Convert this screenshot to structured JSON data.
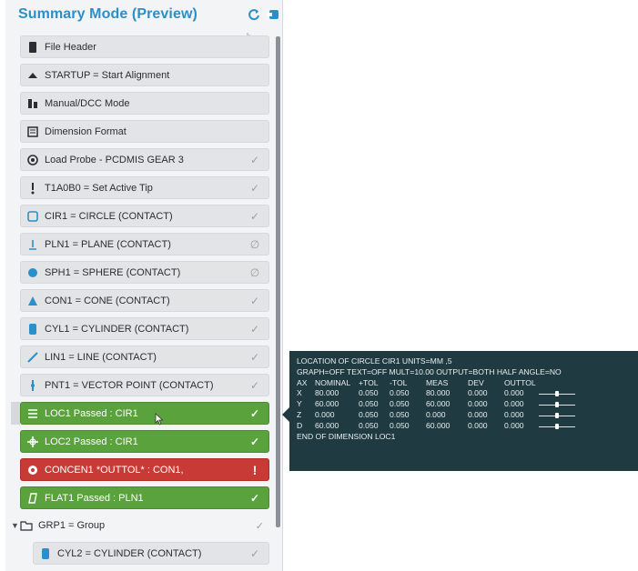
{
  "header": {
    "title": "Summary Mode (Preview)",
    "icons": [
      "refresh-icon",
      "export-icon"
    ]
  },
  "rows": [
    {
      "label": "File Header",
      "icon": "file-icon",
      "status": ""
    },
    {
      "label": "STARTUP = Start Alignment",
      "icon": "alignment-icon",
      "status": ""
    },
    {
      "label": "Manual/DCC Mode",
      "icon": "mode-icon",
      "status": ""
    },
    {
      "label": "Dimension Format",
      "icon": "format-icon",
      "status": ""
    },
    {
      "label": "Load Probe - PCDMIS GEAR 3",
      "icon": "probe-icon",
      "status": "✓"
    },
    {
      "label": "T1A0B0 = Set Active Tip",
      "icon": "tip-icon",
      "status": "✓"
    },
    {
      "label": "CIR1 = CIRCLE (CONTACT)",
      "icon": "circle-icon",
      "status": "✓"
    },
    {
      "label": "PLN1 = PLANE (CONTACT)",
      "icon": "plane-icon",
      "status": "∅"
    },
    {
      "label": "SPH1 = SPHERE (CONTACT)",
      "icon": "sphere-icon",
      "status": "∅"
    },
    {
      "label": "CON1 = CONE (CONTACT)",
      "icon": "cone-icon",
      "status": "✓"
    },
    {
      "label": "CYL1 = CYLINDER (CONTACT)",
      "icon": "cylinder-icon",
      "status": "✓"
    },
    {
      "label": "LIN1 = LINE (CONTACT)",
      "icon": "line-icon",
      "status": "✓"
    },
    {
      "label": "PNT1 = VECTOR POINT (CONTACT)",
      "icon": "point-icon",
      "status": "✓"
    },
    {
      "label": "LOC1 Passed : CIR1",
      "icon": "location-icon",
      "status": "✓"
    },
    {
      "label": "LOC2 Passed : CIR1",
      "icon": "location2-icon",
      "status": "✓"
    },
    {
      "label": "CONCEN1 *OUTTOL* : CON1,",
      "icon": "concentricity-icon",
      "status": "!"
    },
    {
      "label": "FLAT1 Passed : PLN1",
      "icon": "flatness-icon",
      "status": "✓"
    }
  ],
  "group": {
    "label": "GRP1 = Group",
    "status": "✓"
  },
  "group_child": {
    "label": "CYL2 = CYLINDER (CONTACT)",
    "status": "✓"
  },
  "tooltip": {
    "line1": "LOCATION OF CIRCLE CIR1  UNITS=MM ,5",
    "line2": "GRAPH=OFF  TEXT=OFF  MULT=10.00  OUTPUT=BOTH  HALF ANGLE=NO",
    "headers": [
      "AX",
      "NOMINAL",
      "+TOL",
      "-TOL",
      "MEAS",
      "DEV",
      "OUTTOL",
      ""
    ],
    "rows": [
      [
        "X",
        "80.000",
        "0.050",
        "0.050",
        "80.000",
        "0.000",
        "0.000",
        ""
      ],
      [
        "Y",
        "60.000",
        "0.050",
        "0.050",
        "60.000",
        "0.000",
        "0.000",
        ""
      ],
      [
        "Z",
        "0.000",
        "0.050",
        "0.050",
        "0.000",
        "0.000",
        "0.000",
        ""
      ],
      [
        "D",
        "60.000",
        "0.050",
        "0.050",
        "60.000",
        "0.000",
        "0.000",
        ""
      ]
    ],
    "footer": "END OF DIMENSION LOC1"
  },
  "colors": {
    "title": "#2b8fc9",
    "pass": "#5aa23c",
    "fail": "#c83a35",
    "tooltip_bg": "#1f3a40"
  }
}
